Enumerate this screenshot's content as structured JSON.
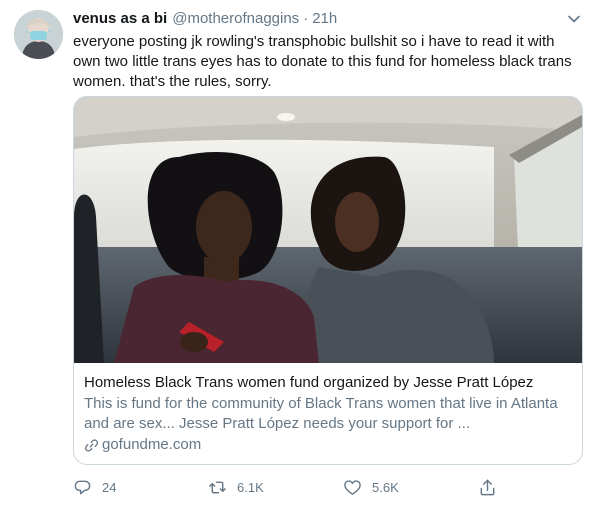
{
  "tweet": {
    "display_name": "venus as a bi",
    "handle": "@motherofnaggins",
    "separator": "·",
    "time": "21h",
    "text": "everyone posting jk rowling's transphobic bullshit so i have to read it with own two little trans eyes has to donate to this fund for homeless black trans women. that's the rules, sorry."
  },
  "card": {
    "title": "Homeless Black Trans women fund organized by Jesse Pratt López",
    "description": "This is fund for the community of Black Trans women that live in Atlanta and are sex... Jesse Pratt López needs your support for ...",
    "domain": "gofundme.com"
  },
  "actions": {
    "replies": "24",
    "retweets": "6.1K",
    "likes": "5.6K"
  },
  "icons": {
    "caret": "chevron-down-icon",
    "link": "link-icon",
    "reply": "reply-icon",
    "retweet": "retweet-icon",
    "like": "heart-icon",
    "share": "share-icon"
  },
  "colors": {
    "text": "#14171a",
    "secondary": "#657786",
    "border": "#ccd6dd"
  }
}
